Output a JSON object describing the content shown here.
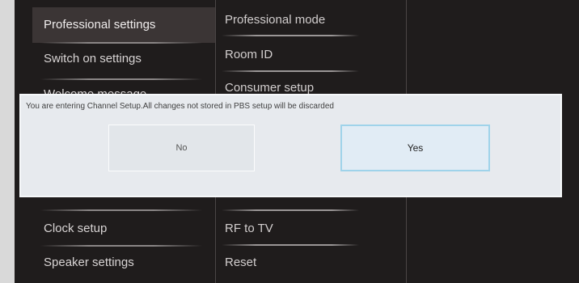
{
  "left_menu": {
    "items": [
      {
        "label": "Professional settings",
        "active": true
      },
      {
        "label": "Switch on settings",
        "active": false
      },
      {
        "label": "Welcome message",
        "active": false
      },
      {
        "label": "Clock setup",
        "active": false
      },
      {
        "label": "Speaker settings",
        "active": false
      }
    ]
  },
  "middle_menu": {
    "items": [
      {
        "label": "Professional mode"
      },
      {
        "label": "Room ID"
      },
      {
        "label": "Consumer setup"
      },
      {
        "label": "RF to TV"
      },
      {
        "label": "Reset"
      }
    ]
  },
  "dialog": {
    "message": "You are entering Channel Setup.All changes not stored in PBS setup will be discarded",
    "no_label": "No",
    "yes_label": "Yes",
    "selected": "Yes"
  }
}
